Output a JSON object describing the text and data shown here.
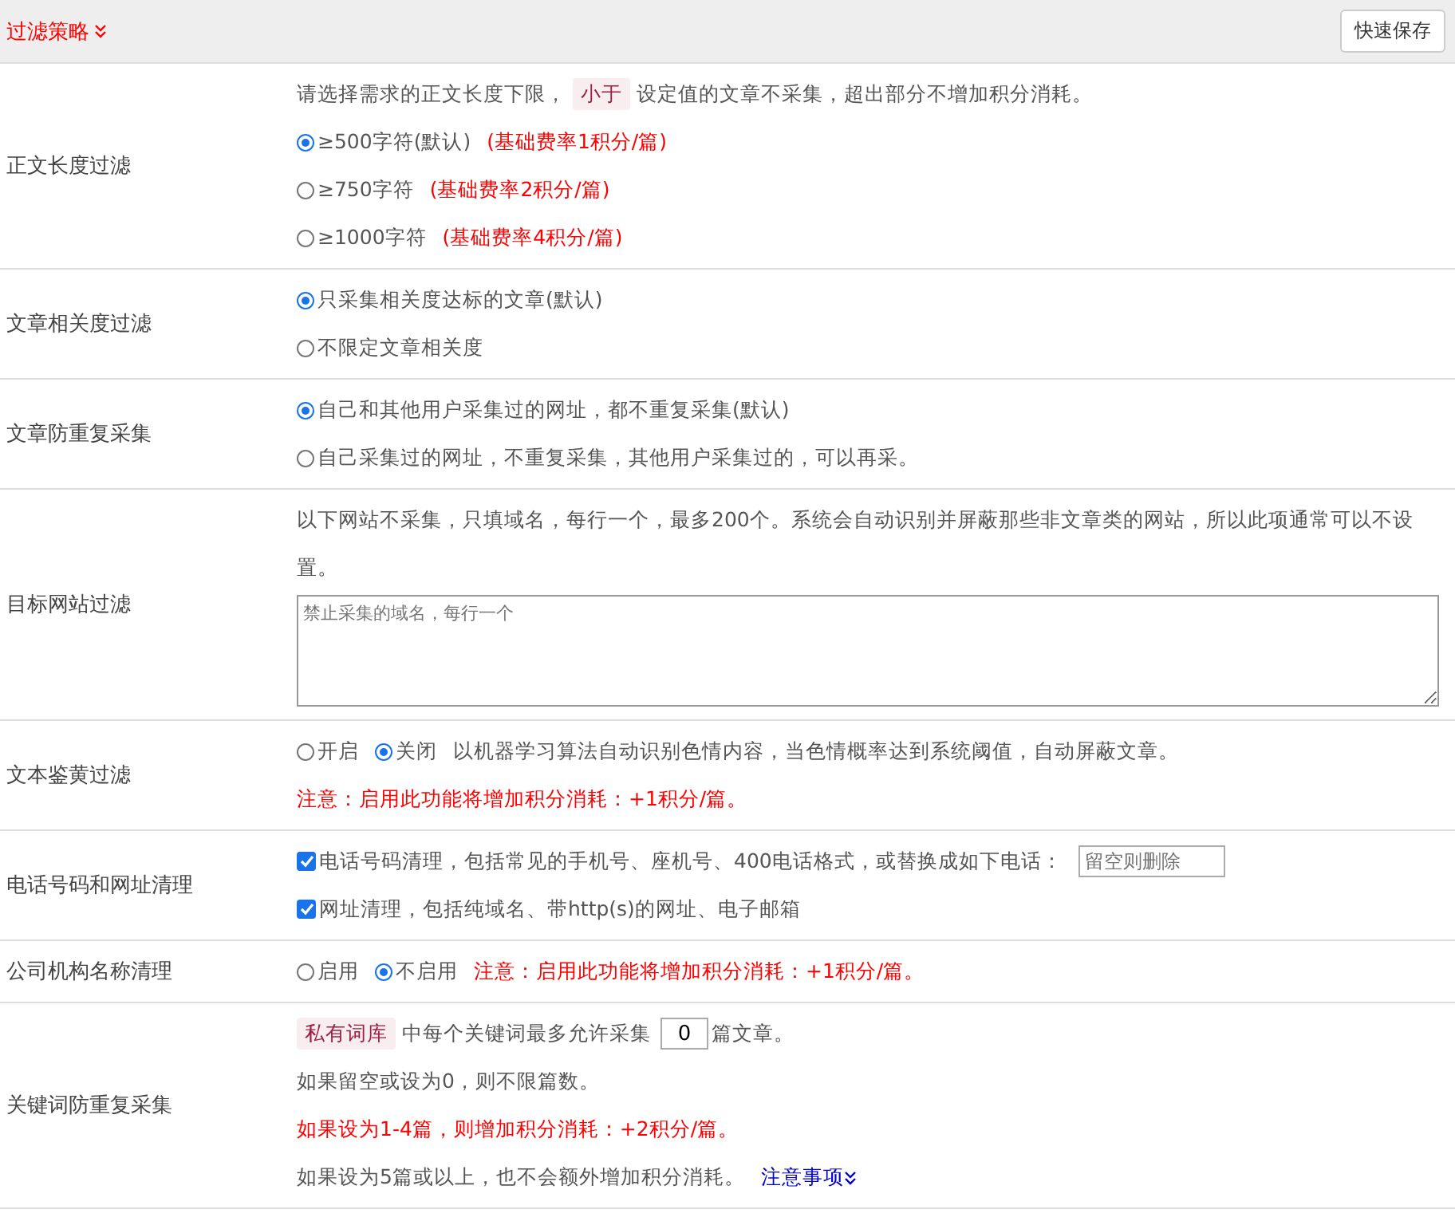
{
  "header": {
    "title": "过滤策略",
    "save_button": "快速保存"
  },
  "rows": [
    {
      "label": "正文长度过滤",
      "lines": [
        {
          "parts": [
            {
              "kind": "text",
              "text": "请选择需求的正文长度下限，"
            },
            {
              "kind": "tag",
              "text": "小于"
            },
            {
              "kind": "text",
              "text": "设定值的文章不采集，超出部分不增加积分消耗。"
            }
          ]
        },
        {
          "parts": [
            {
              "kind": "radio",
              "label": "≥500字符(默认)",
              "selected": true
            },
            {
              "kind": "red",
              "text": "(基础费率1积分/篇)"
            }
          ]
        },
        {
          "parts": [
            {
              "kind": "radio",
              "label": "≥750字符",
              "selected": false
            },
            {
              "kind": "red",
              "text": "(基础费率2积分/篇)"
            }
          ]
        },
        {
          "parts": [
            {
              "kind": "radio",
              "label": "≥1000字符",
              "selected": false
            },
            {
              "kind": "red",
              "text": "(基础费率4积分/篇)"
            }
          ]
        }
      ]
    },
    {
      "label": "文章相关度过滤",
      "lines": [
        {
          "parts": [
            {
              "kind": "radio",
              "label": "只采集相关度达标的文章(默认)",
              "selected": true
            }
          ]
        },
        {
          "parts": [
            {
              "kind": "radio",
              "label": "不限定文章相关度",
              "selected": false
            }
          ]
        }
      ]
    },
    {
      "label": "文章防重复采集",
      "lines": [
        {
          "parts": [
            {
              "kind": "radio",
              "label": "自己和其他用户采集过的网址，都不重复采集(默认)",
              "selected": true
            }
          ]
        },
        {
          "parts": [
            {
              "kind": "radio",
              "label": "自己采集过的网址，不重复采集，其他用户采集过的，可以再采。",
              "selected": false
            }
          ]
        }
      ]
    },
    {
      "label": "目标网站过滤",
      "lines": [
        {
          "parts": [
            {
              "kind": "text",
              "text": "以下网站不采集，只填域名，每行一个，最多200个。系统会自动识别并屏蔽那些非文章类的网站，所以此项通常可以不设置。"
            }
          ]
        },
        {
          "parts": [
            {
              "kind": "textarea",
              "placeholder": "禁止采集的域名，每行一个"
            }
          ]
        }
      ]
    },
    {
      "label": "文本鉴黄过滤",
      "lines": [
        {
          "parts": [
            {
              "kind": "radio",
              "label": "开启",
              "selected": false
            },
            {
              "kind": "radio",
              "label": "关闭",
              "selected": true
            },
            {
              "kind": "text",
              "text": "以机器学习算法自动识别色情内容，当色情概率达到系统阈值，自动屏蔽文章。"
            }
          ]
        },
        {
          "parts": [
            {
              "kind": "red",
              "text": "注意：启用此功能将增加积分消耗：+1积分/篇。"
            }
          ]
        }
      ]
    },
    {
      "label": "电话号码和网址清理",
      "lines": [
        {
          "parts": [
            {
              "kind": "checkbox",
              "label": "电话号码清理，包括常见的手机号、座机号、400电话格式，或替换成如下电话：",
              "checked": true
            },
            {
              "kind": "field",
              "placeholder": "留空则删除"
            }
          ]
        },
        {
          "parts": [
            {
              "kind": "checkbox",
              "label": "网址清理，包括纯域名、带http(s)的网址、电子邮箱",
              "checked": true
            }
          ]
        }
      ]
    },
    {
      "label": "公司机构名称清理",
      "lines": [
        {
          "parts": [
            {
              "kind": "radio",
              "label": "启用",
              "selected": false
            },
            {
              "kind": "radio",
              "label": "不启用",
              "selected": true
            },
            {
              "kind": "red",
              "text": "注意：启用此功能将增加积分消耗：+1积分/篇。"
            }
          ]
        }
      ]
    },
    {
      "label": "关键词防重复采集",
      "lines": [
        {
          "parts": [
            {
              "kind": "tag",
              "text": "私有词库"
            },
            {
              "kind": "text",
              "text": "中每个关键词最多允许采集"
            },
            {
              "kind": "input",
              "value": "0"
            },
            {
              "kind": "text",
              "text": "篇文章。"
            }
          ]
        },
        {
          "parts": [
            {
              "kind": "text",
              "text": "如果留空或设为0，则不限篇数。"
            }
          ]
        },
        {
          "parts": [
            {
              "kind": "red",
              "text": "如果设为1-4篇，则增加积分消耗：+2积分/篇。"
            }
          ]
        },
        {
          "parts": [
            {
              "kind": "text",
              "text": "如果设为5篇或以上，也不会额外增加积分消耗。"
            },
            {
              "kind": "link",
              "text": "注意事项"
            }
          ]
        }
      ]
    }
  ]
}
